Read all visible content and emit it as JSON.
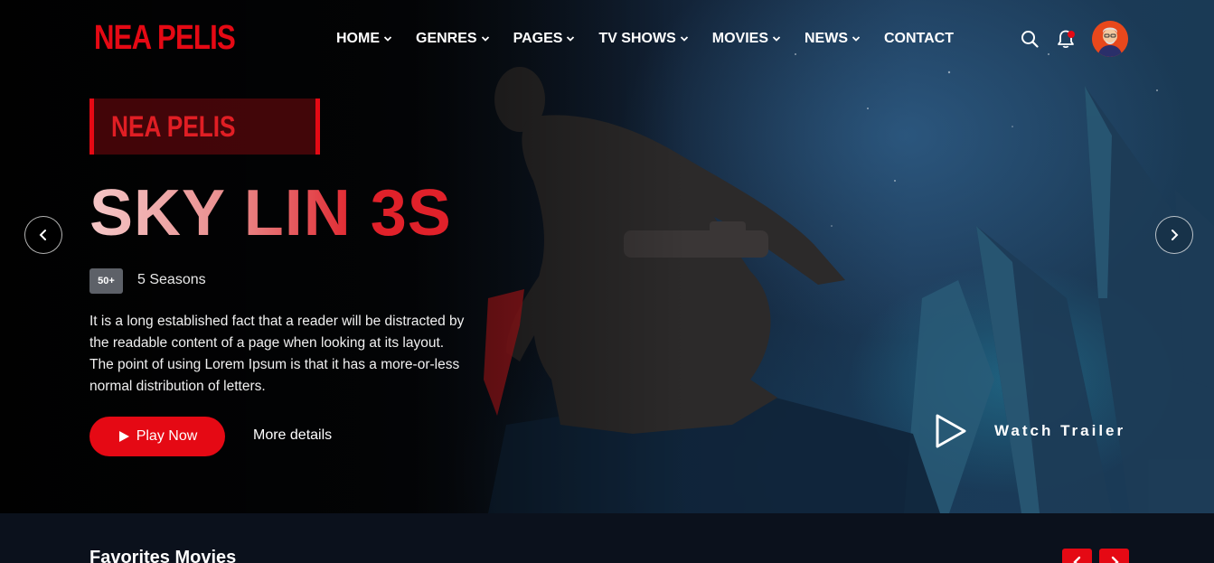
{
  "brand": {
    "logo": "NEA PELIS",
    "accent": "#e50914"
  },
  "nav": {
    "items": [
      {
        "label": "HOME",
        "dropdown": true
      },
      {
        "label": "GENRES",
        "dropdown": true
      },
      {
        "label": "PAGES",
        "dropdown": true
      },
      {
        "label": "TV SHOWS",
        "dropdown": true
      },
      {
        "label": "MOVIES",
        "dropdown": true
      },
      {
        "label": "NEWS",
        "dropdown": true
      },
      {
        "label": "CONTACT",
        "dropdown": false
      }
    ]
  },
  "header_icons": [
    "search-icon",
    "bell-icon",
    "avatar"
  ],
  "hero": {
    "badge": "NEA PELIS",
    "title": "SKY LIN 3S",
    "rating": "50+",
    "seasons": "5 Seasons",
    "description": "It is a long established fact that a reader will be distracted by the readable content of a page when looking at its layout. The point of using Lorem Ipsum is that it has a more-or-less normal distribution of letters.",
    "play_label": "Play Now",
    "more_label": "More details",
    "trailer_label": "Watch Trailer"
  },
  "favorites": {
    "title": "Favorites Movies"
  }
}
